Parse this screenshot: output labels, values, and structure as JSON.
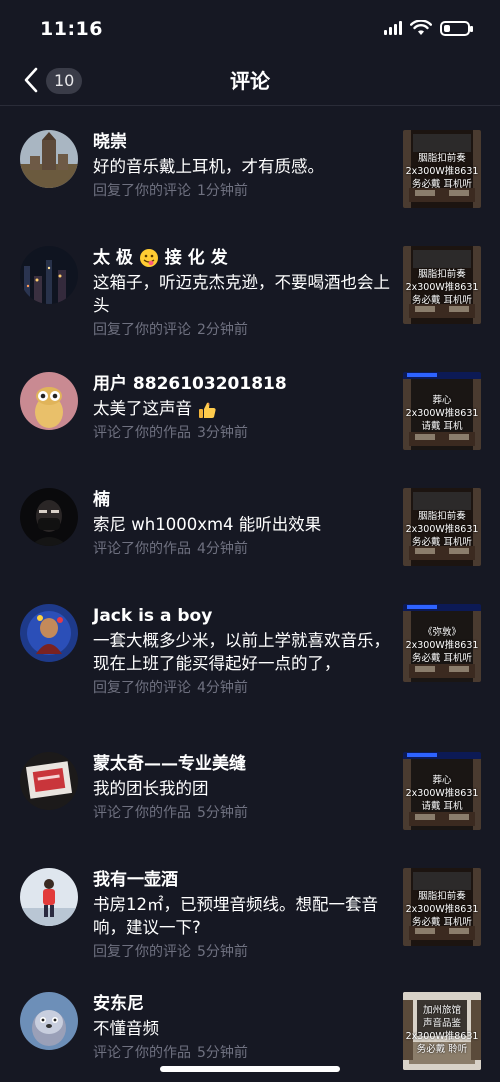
{
  "status_bar": {
    "time": "11:16",
    "battery_level": 0.25
  },
  "nav": {
    "back_icon": "chevron-left-icon",
    "count": "10",
    "title": "评论"
  },
  "comments": [
    {
      "user": "晓崇",
      "text": "好的音乐戴上耳机，才有质感。",
      "action": "回复了你的评论",
      "time": "1分钟前",
      "thumb_lines": [
        "胭脂扣前奏",
        "2x300W推8631",
        "务必戴  耳机听"
      ]
    },
    {
      "user": "太 极",
      "user_suffix": "接 化 发",
      "user_emoji": "tongue-face-emoji",
      "text": "这箱子，听迈克杰克逊，不要喝酒也会上头",
      "action": "回复了你的评论",
      "time": "2分钟前",
      "thumb_lines": [
        "胭脂扣前奏",
        "2x300W推8631",
        "务必戴  耳机听"
      ]
    },
    {
      "user": "用户 8826103201818",
      "text": "太美了这声音",
      "text_emoji": "thumbs-up-emoji",
      "action": "评论了你的作品",
      "time": "3分钟前",
      "thumb_lines": [
        "葬心",
        "2x300W推8631",
        "请戴  耳机"
      ]
    },
    {
      "user": "楠",
      "text": "索尼 wh1000xm4 能听出效果",
      "action": "评论了你的作品",
      "time": "4分钟前",
      "thumb_lines": [
        "胭脂扣前奏",
        "2x300W推8631",
        "务必戴  耳机听"
      ]
    },
    {
      "user": "Jack is a boy",
      "text": "一套大概多少米，以前上学就喜欢音乐，现在上班了能买得起好一点的了，",
      "action": "回复了你的评论",
      "time": "4分钟前",
      "thumb_lines": [
        "《弥敦》",
        "2x300W推8631",
        "务必戴  耳机听"
      ]
    },
    {
      "user": "蒙太奇——专业美缝",
      "text": "我的团长我的团",
      "action": "评论了你的作品",
      "time": "5分钟前",
      "thumb_lines": [
        "葬心",
        "2x300W推8631",
        "请戴  耳机"
      ]
    },
    {
      "user": "我有一壶酒",
      "text": "书房12㎡，已预埋音频线。想配一套音响，建议一下?",
      "action": "回复了你的评论",
      "time": "5分钟前",
      "thumb_lines": [
        "胭脂扣前奏",
        "2x300W推8631",
        "务必戴  耳机听"
      ]
    },
    {
      "user": "安东尼",
      "text": "不懂音频",
      "action": "评论了你的作品",
      "time": "5分钟前",
      "thumb_lines": [
        "加州旅馆",
        "声音品鉴",
        "2x300W推8631",
        "务必戴  聆听"
      ]
    }
  ],
  "colors": {
    "background": "#161823",
    "meta": "#6f7180",
    "badge": "#3a3c48"
  }
}
